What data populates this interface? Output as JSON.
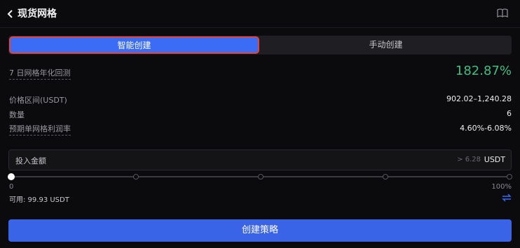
{
  "header": {
    "title": "现货网格",
    "back_icon": "chevron-left-icon",
    "help_icon": "book-icon"
  },
  "tabs": [
    {
      "label": "智能创建",
      "active": true
    },
    {
      "label": "手动创建",
      "active": false
    }
  ],
  "backtest": {
    "label": "7 日网格年化回测",
    "value": "182.87%"
  },
  "params": {
    "range_label": "价格区间(USDT)",
    "range_value": "902.02–1,240.28",
    "count_label": "数量",
    "count_value": "6",
    "profit_label": "预期单网格利润率",
    "profit_value": "4.60%-6.08%"
  },
  "amount": {
    "label": "投入金额",
    "min": "> 6.28",
    "unit": "USDT"
  },
  "slider": {
    "min_label": "0",
    "max_label": "100%",
    "value_percent": 0,
    "nodes": 5
  },
  "available": {
    "text": "可用: 99.93 USDT",
    "swap_icon": "swap-icon"
  },
  "action": {
    "create_label": "创建策略"
  },
  "colors": {
    "accent": "#3b6cf6",
    "positive": "#3fbf86",
    "background": "#0b0b0d",
    "tab_outline": "#e0443c"
  }
}
